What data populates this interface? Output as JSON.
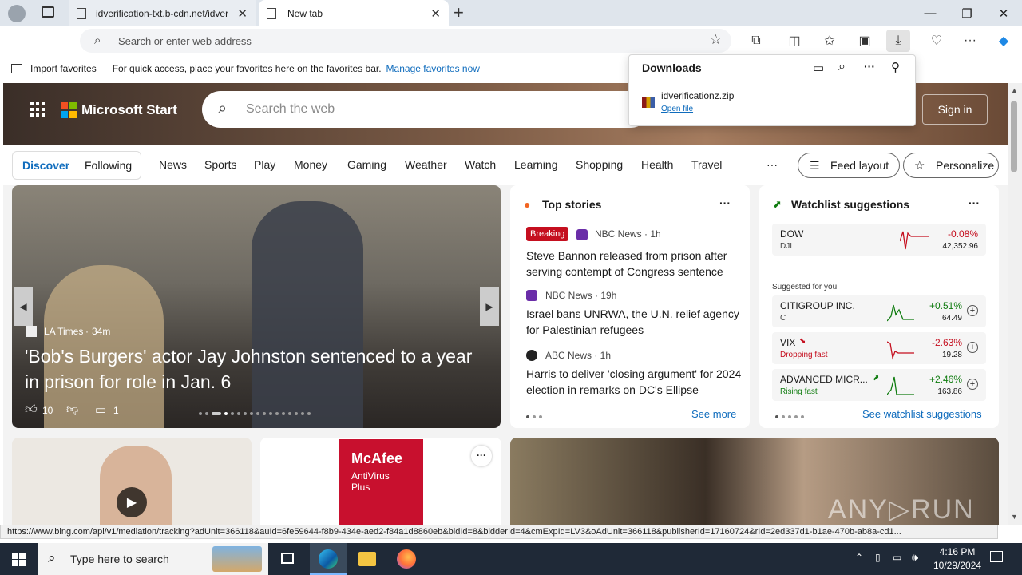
{
  "browser": {
    "tabs": [
      {
        "label": "idverification-txt.b-cdn.net/idver"
      },
      {
        "label": "New tab"
      }
    ],
    "address_placeholder": "Search or enter web address",
    "favbar": {
      "import_label": "Import favorites",
      "hint": "For quick access, place your favorites here on the favorites bar.",
      "manage_link": "Manage favorites now"
    }
  },
  "downloads": {
    "title": "Downloads",
    "file": "idverificationz.zip",
    "action": "Open file"
  },
  "msn": {
    "brand": "Microsoft Start",
    "search_placeholder": "Search the web",
    "signin": "Sign in",
    "tabs": [
      "Discover",
      "Following"
    ],
    "nav": [
      "News",
      "Sports",
      "Play",
      "Money",
      "Gaming",
      "Weather",
      "Watch",
      "Learning",
      "Shopping",
      "Health",
      "Travel"
    ],
    "more": "···",
    "feed_layout": "Feed layout",
    "personalize": "Personalize"
  },
  "hero": {
    "source": "LA Times",
    "age": "34m",
    "headline": "'Bob's Burgers' actor Jay Johnston sentenced to a year in prison for role in Jan. 6",
    "likes": "10",
    "comments": "1"
  },
  "top_stories": {
    "title": "Top stories",
    "see_more": "See more",
    "items": [
      {
        "badge": "Breaking",
        "source": "NBC News · 1h",
        "headline": "Steve Bannon released from prison after serving contempt of Congress sentence"
      },
      {
        "source": "NBC News · 19h",
        "headline": "Israel bans UNRWA, the U.N. relief agency for Palestinian refugees"
      },
      {
        "source": "ABC News · 1h",
        "headline": "Harris to deliver 'closing argument' for 2024 election in remarks on DC's Ellipse"
      }
    ]
  },
  "watchlist": {
    "title": "Watchlist suggestions",
    "suggested": "Suggested for you",
    "see_link": "See watchlist suggestions",
    "dow": {
      "name": "DOW",
      "ticker": "DJI",
      "change": "-0.08%",
      "price": "42,352.96"
    },
    "items": [
      {
        "name": "CITIGROUP INC.",
        "sub": "C",
        "change": "+0.51%",
        "price": "64.49"
      },
      {
        "name": "VIX",
        "sub": "Dropping fast",
        "change": "-2.63%",
        "price": "19.28"
      },
      {
        "name": "ADVANCED MICR...",
        "sub": "Rising fast",
        "change": "+2.46%",
        "price": "163.86"
      }
    ]
  },
  "ad": {
    "brand": "McAfee",
    "product": "AntiVirus Plus"
  },
  "statusbar": "https://www.bing.com/api/v1/mediation/tracking?adUnit=366118&auId=6fe59644-f8b9-434e-aed2-f84a1d8860eb&bidId=8&bidderId=4&cmExpId=LV3&oAdUnit=366118&publisherId=17160724&rId=2ed337d1-b1ae-470b-ab8a-cd1...",
  "taskbar": {
    "search_placeholder": "Type here to search",
    "time": "4:16 PM",
    "date": "10/29/2024"
  },
  "colors": {
    "accent": "#0f6cbd",
    "negative": "#c50f1f",
    "positive": "#107c10"
  }
}
